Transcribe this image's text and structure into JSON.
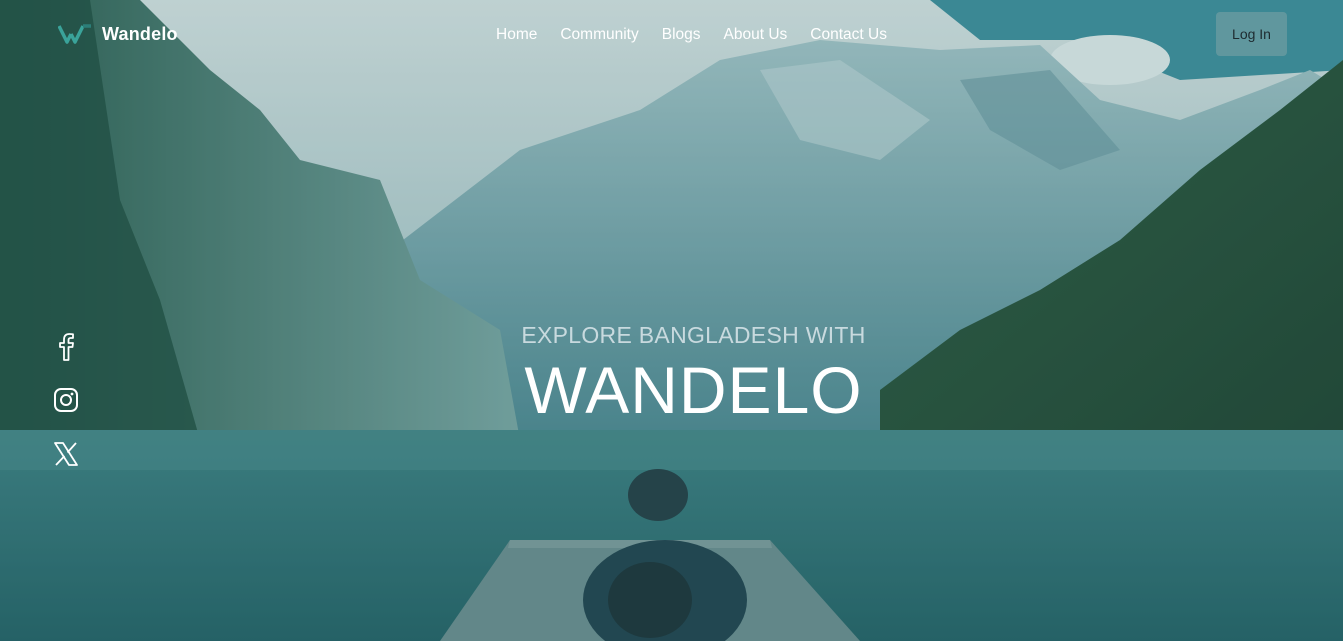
{
  "brand": {
    "name": "Wandelo",
    "logo_icon": "w-logo-icon"
  },
  "nav": {
    "items": [
      {
        "label": "Home"
      },
      {
        "label": "Community"
      },
      {
        "label": "Blogs"
      },
      {
        "label": "About Us"
      },
      {
        "label": "Contact Us"
      }
    ]
  },
  "auth": {
    "login_label": "Log In"
  },
  "social": {
    "icons": [
      "facebook-icon",
      "instagram-icon",
      "x-icon"
    ]
  },
  "hero": {
    "subtitle": "EXPLORE BANGLADESH WITH",
    "title": "WANDELO"
  },
  "colors": {
    "overlay": "#2f6f73",
    "brand_teal": "#3aa39a",
    "white": "#ffffff"
  }
}
